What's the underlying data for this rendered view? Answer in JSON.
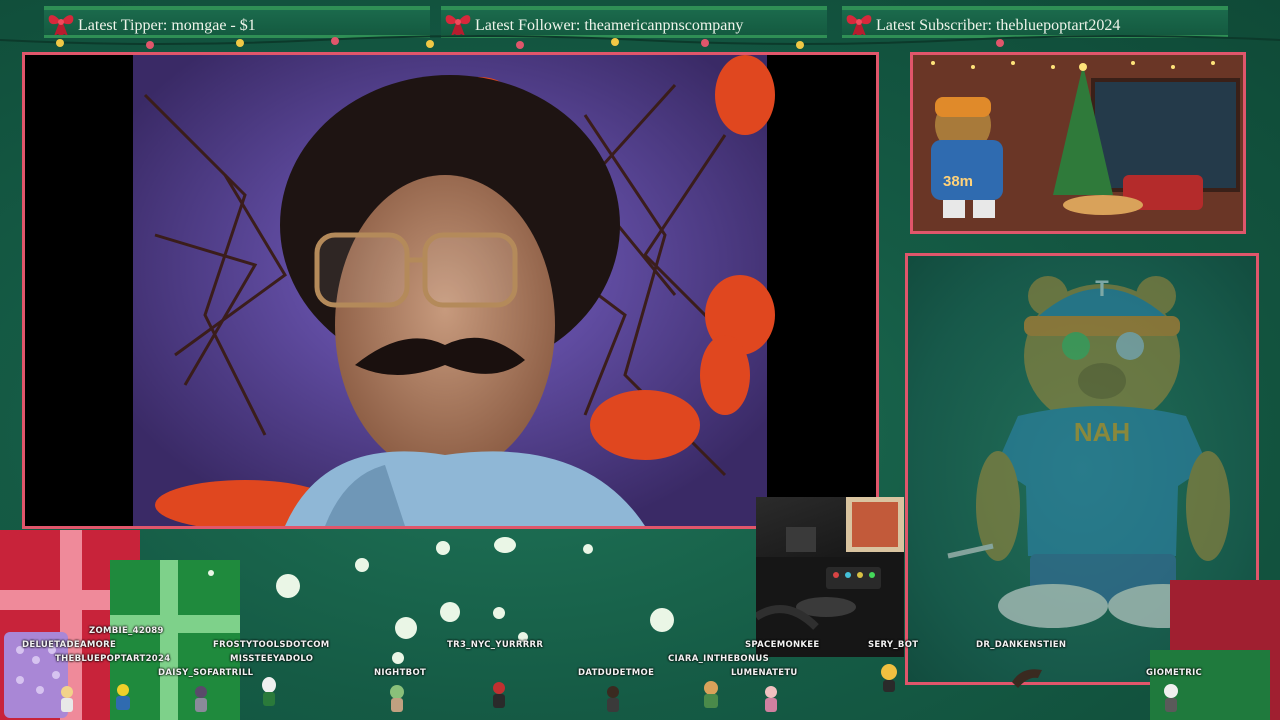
{
  "banners": {
    "tipper": "Latest Tipper: momgae - $1",
    "follower": "Latest Follower: theamericanpnscompany",
    "subscriber": "Latest Subscriber: thebluepoptart2024"
  },
  "camera": {
    "badge": "38m"
  },
  "chatters": [
    "ZOMBIE_42089",
    "DELUETADEAMORE",
    "THEBLUEPOPTART2024",
    "DAISY_SOFARTRILL",
    "FROSTYTOOLSDOTCOM",
    "MISSTEEYADOLO",
    "NIGHTBOT",
    "TR3_NYC_YURRRRR",
    "DATDUDETMOE",
    "CIARA_INTHEBONUS",
    "LUMENATETU",
    "SPACEMONKEE",
    "SERY_BOT",
    "DR_DANKENSTIEN",
    "GIOMETRIC"
  ],
  "colors": {
    "frame": "#e0566b",
    "background": "#155b45",
    "banner_text": "#eef4ea"
  },
  "icons": {
    "banner_bow": "ribbon-bow-icon"
  }
}
